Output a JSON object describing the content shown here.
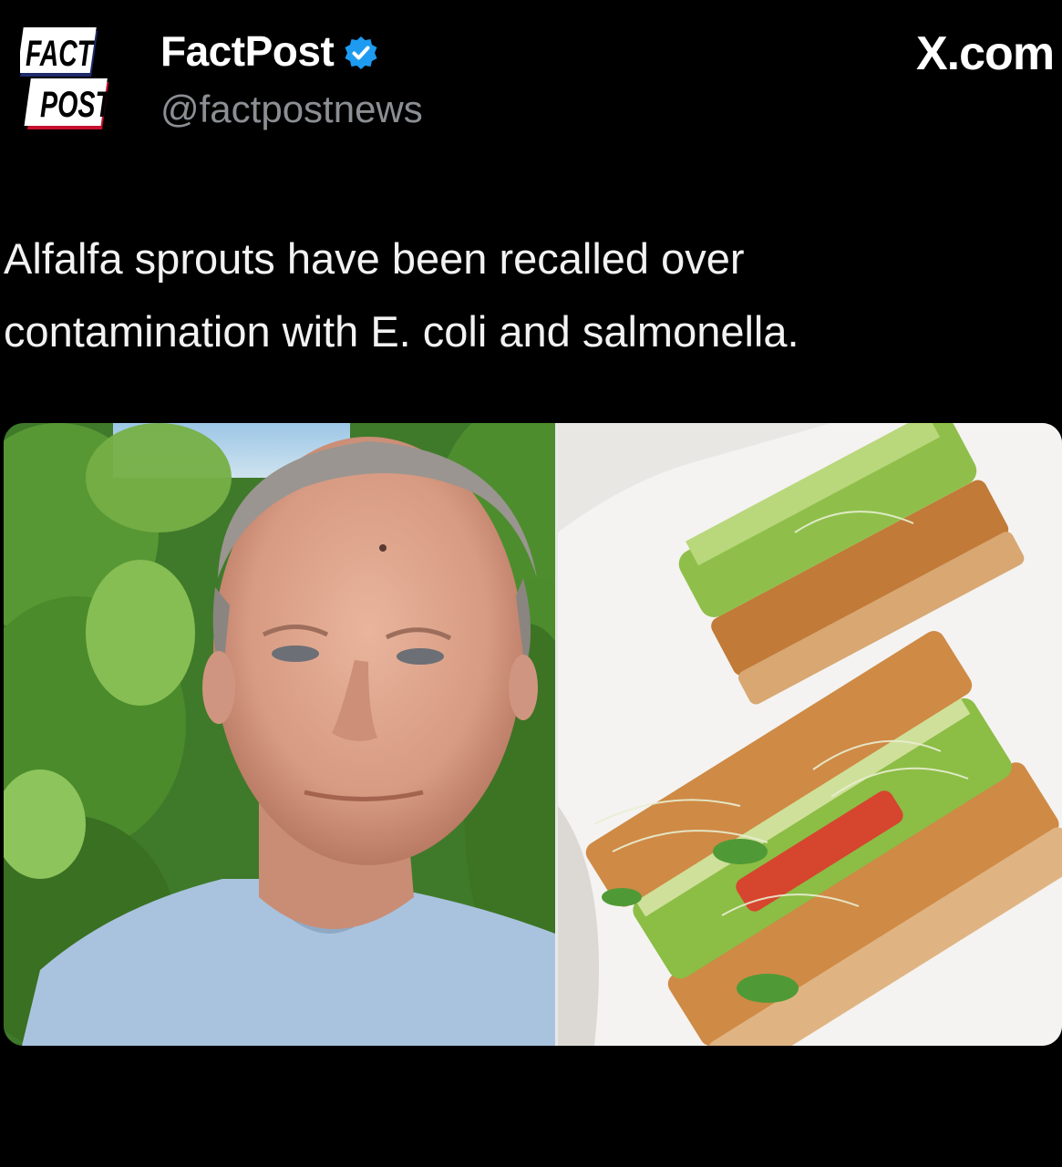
{
  "account": {
    "logo_line1": "FACT",
    "logo_line2": "POST",
    "display_name": "FactPost",
    "handle": "@factpostnews",
    "verified": true
  },
  "watermark": "X.com",
  "tweet": {
    "text_line1": "Alfalfa sprouts have been recalled over",
    "text_line2": "contamination with E. coli and salmonella."
  },
  "media": {
    "left_image_icon": "person-portrait-image",
    "right_image_icon": "sprout-sandwich-image"
  },
  "colors": {
    "background": "#000000",
    "handle_gray": "#8b8f94",
    "verified_blue": "#1d9bf0",
    "logo_navy": "#1f2a6b",
    "logo_red": "#c8102e"
  }
}
